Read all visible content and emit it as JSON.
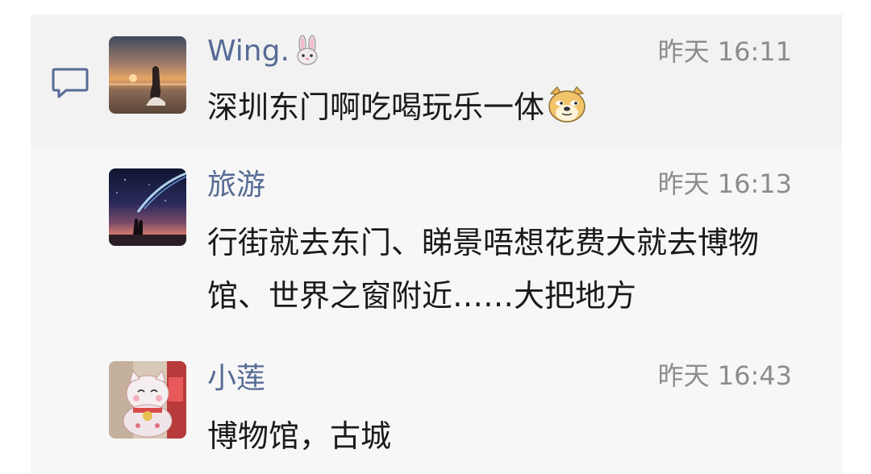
{
  "comments": [
    {
      "name": "Wing.",
      "name_emoji": "rabbit-face-icon",
      "time": "昨天 16:11",
      "text": "深圳东门啊吃喝玩乐一体",
      "text_emoji": "doge-face-icon",
      "avatar": "sunset-silhouette-avatar"
    },
    {
      "name": "旅游",
      "time": "昨天 16:13",
      "text": "行街就去东门、睇景唔想花费大就去博物馆、世界之窗附近……大把地方",
      "avatar": "starry-sky-couple-avatar"
    },
    {
      "name": "小莲",
      "time": "昨天 16:43",
      "text": "博物馆，古城",
      "avatar": "lucky-cat-avatar"
    }
  ],
  "colors": {
    "name": "#576b95",
    "time": "#8c8c8c",
    "text": "#1a1a1a",
    "panel": "#f7f7f7",
    "highlight": "#f2f2f2"
  }
}
